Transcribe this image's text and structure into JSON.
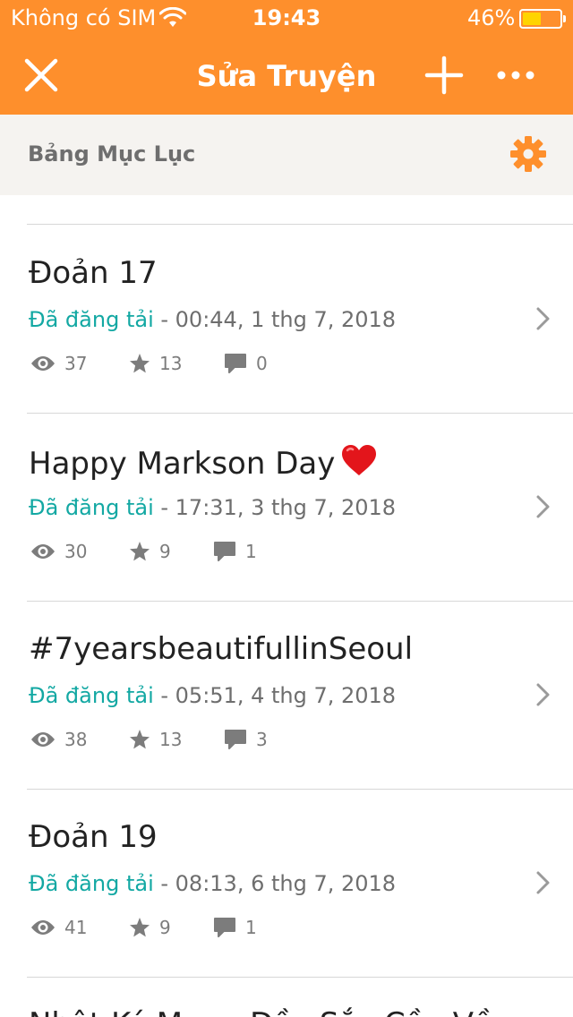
{
  "status_bar": {
    "carrier": "Không có SIM",
    "time": "19:43",
    "battery_percent": "46%",
    "battery_level": 0.46
  },
  "nav": {
    "title": "Sửa Truyện"
  },
  "toc": {
    "label": "Bảng Mục Lục"
  },
  "parts": [
    {
      "title": "Đoản 17",
      "state": "Đã đăng tải",
      "timestamp": " - 00:44, 1 thg 7, 2018",
      "views": "37",
      "votes": "13",
      "comments": "0",
      "heart": false
    },
    {
      "title": "Happy Markson Day",
      "state": "Đã đăng tải",
      "timestamp": " - 17:31, 3 thg 7, 2018",
      "views": "30",
      "votes": "9",
      "comments": "1",
      "heart": true
    },
    {
      "title": "#7yearsbeautifullinSeoul",
      "state": "Đã đăng tải",
      "timestamp": " - 05:51, 4 thg 7, 2018",
      "views": "38",
      "votes": "13",
      "comments": "3",
      "heart": false
    },
    {
      "title": "Đoản 19",
      "state": "Đã đăng tải",
      "timestamp": " - 08:13, 6 thg 7, 2018",
      "views": "41",
      "votes": "9",
      "comments": "1",
      "heart": false
    }
  ],
  "partial_next_title": "Nhật Ký Mang Đầy Sắc Cầu Vồng",
  "colors": {
    "accent": "#fe8f2c",
    "published": "#13a8a3"
  }
}
